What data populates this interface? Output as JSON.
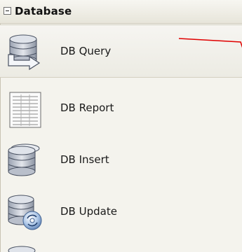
{
  "group": {
    "title": "Database",
    "toggle_icon": "minus-box-icon"
  },
  "items": [
    {
      "label": "DB Query",
      "icon": "database-query-icon"
    },
    {
      "label": "DB Report",
      "icon": "report-document-icon"
    },
    {
      "label": "DB Insert",
      "icon": "database-insert-icon"
    },
    {
      "label": "DB Update",
      "icon": "database-update-icon"
    }
  ],
  "colors": {
    "panel_background": "#f4f3ed",
    "marker_line": "#e00000",
    "database_icon_fill": "#c7ccd6"
  }
}
